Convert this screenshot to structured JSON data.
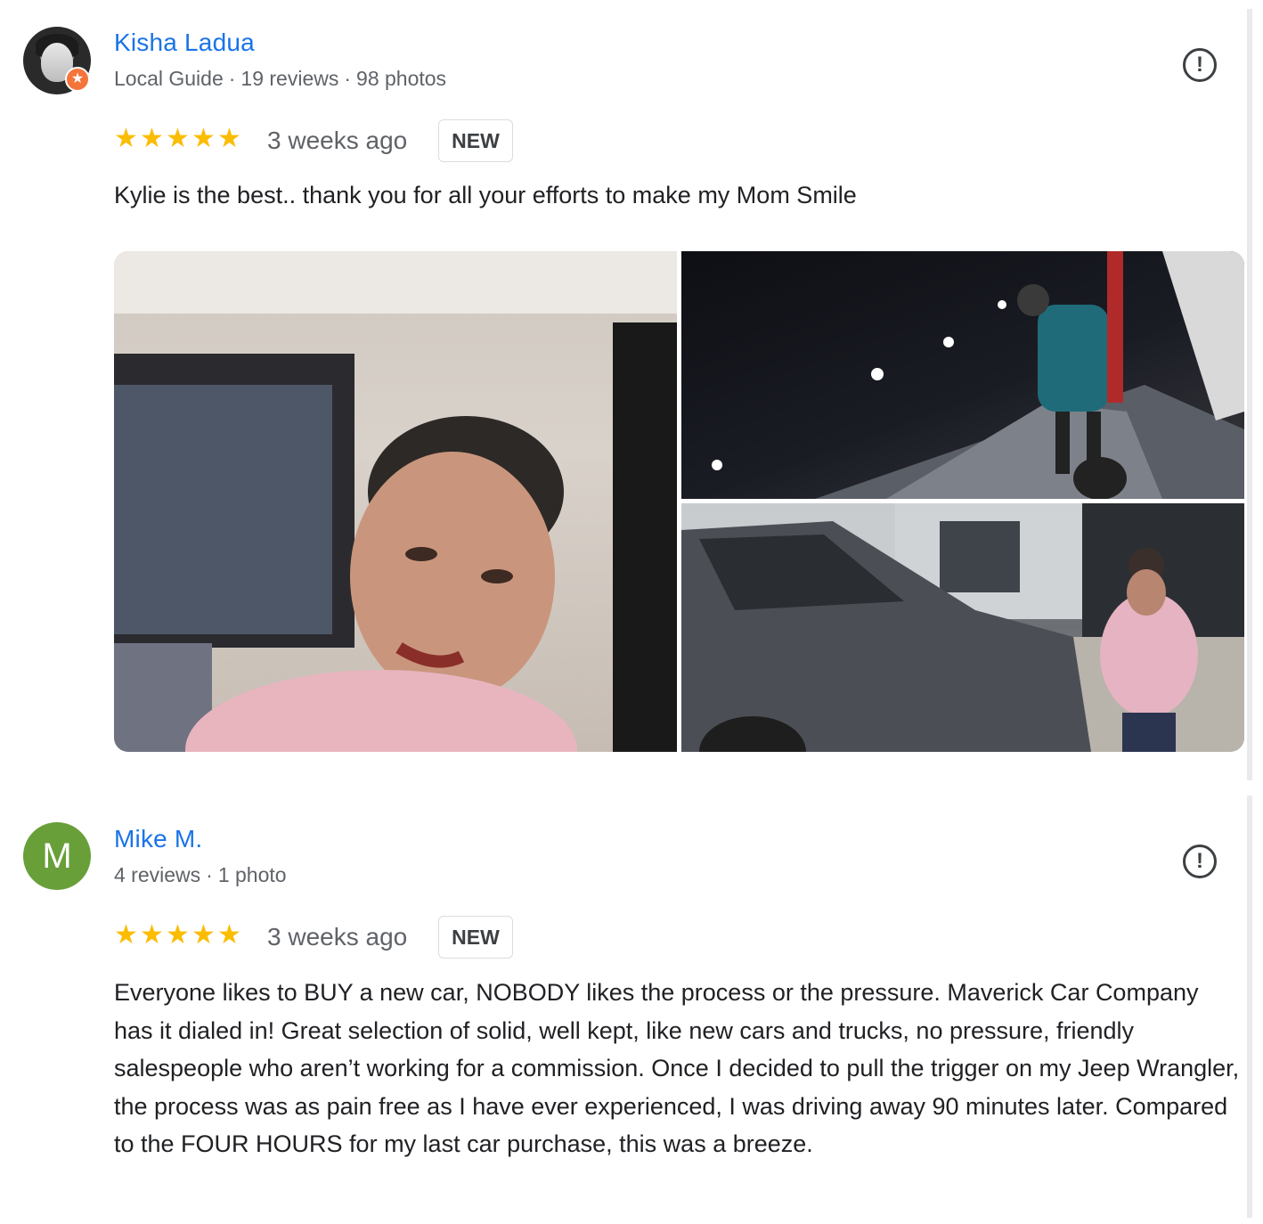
{
  "reviews": [
    {
      "name": "Kisha Ladua",
      "meta": [
        "Local Guide",
        "19 reviews",
        "98 photos"
      ],
      "rating": 5,
      "time": "3 weeks ago",
      "badge": "NEW",
      "text": "Kylie is the best.. thank you for all your efforts to make my Mom Smile",
      "avatar_icon": "profile-photo",
      "badge_icon": "local-guide-star-icon",
      "photo_count": 3
    },
    {
      "name": "Mike M.",
      "avatar_letter": "M",
      "meta": [
        "4 reviews",
        "1 photo"
      ],
      "rating": 5,
      "time": "3 weeks ago",
      "badge": "NEW",
      "text": "Everyone likes to BUY a new car, NOBODY likes the process or the pressure. Maverick Car Company has it dialed in! Great selection of solid, well kept, like new cars and trucks, no pressure, friendly salespeople who aren’t working for a commission. Once I decided to pull the trigger on my Jeep Wrangler, the process was as pain free as I have ever experienced, I was driving away 90 minutes later. Compared to the FOUR HOURS for my last car purchase, this was a breeze."
    }
  ],
  "colors": {
    "name": "#1a73e8",
    "star": "#fbbc04",
    "avatar_m": "#689f38",
    "guide_badge": "#f4743b"
  },
  "icons": {
    "report": "flag-report-icon",
    "star": "star-icon"
  }
}
